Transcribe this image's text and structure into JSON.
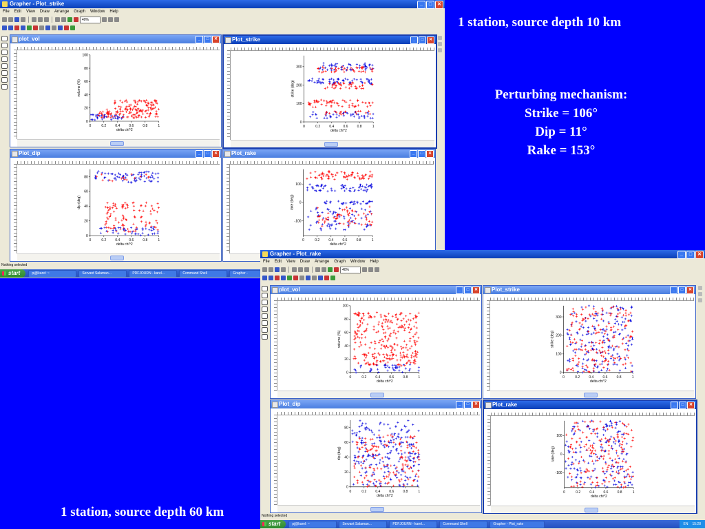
{
  "slide": {
    "heading_top": "1 station, source depth 10  km",
    "heading_bottom": "1 station, source depth 60  km",
    "mechanism": {
      "title": "Perturbing mechanism:",
      "strike": "Strike = 106°",
      "dip": "Dip = 11°",
      "rake": "Rake =  153°"
    }
  },
  "colors": {
    "slide_bg": "#0000ff",
    "series_red": "#ff0000",
    "series_blue": "#0000dd",
    "title_blue": "#0a3fb8"
  },
  "icons": [
    "app-icon",
    "minimize-icon",
    "maximize-icon",
    "close-icon",
    "windows-start-icon"
  ],
  "menu": [
    "File",
    "Edit",
    "View",
    "Draw",
    "Arrange",
    "Graph",
    "Window",
    "Help"
  ],
  "windows": [
    {
      "title": "Grapher - Plot_strike",
      "zoom": "40%",
      "status": "Nothing selected",
      "panels": [
        {
          "title": "plot_vol",
          "active": false,
          "kind": "vol",
          "density": 1,
          "y_label": "volume (%)",
          "x_label": "delta chi^2",
          "x_ticks": [
            "0",
            "0.2",
            "0.4",
            "0.6",
            "0.8",
            "1"
          ],
          "y_ticks": [
            "0",
            "20",
            "40",
            "60",
            "80",
            "100"
          ]
        },
        {
          "title": "Plot_strike",
          "active": true,
          "kind": "strike",
          "density": 1,
          "y_label": "strike (deg)",
          "x_label": "delta chi^2",
          "x_ticks": [
            "0",
            "0.2",
            "0.4",
            "0.6",
            "0.8",
            "1"
          ],
          "y_ticks": [
            "0",
            "100",
            "200",
            "300"
          ]
        },
        {
          "title": "Plot_dip",
          "active": false,
          "kind": "dip",
          "density": 1,
          "y_label": "dip (deg)",
          "x_label": "delta chi^2",
          "x_ticks": [
            "0",
            "0.2",
            "0.4",
            "0.6",
            "0.8",
            "1"
          ],
          "y_ticks": [
            "0",
            "20",
            "40",
            "60",
            "80"
          ]
        },
        {
          "title": "Plot_rake",
          "active": false,
          "kind": "rake",
          "density": 1,
          "y_label": "rake (deg)",
          "x_label": "delta chi^2",
          "x_ticks": [
            "0",
            "0.2",
            "0.4",
            "0.6",
            "0.8",
            "1"
          ],
          "y_ticks": [
            "-100",
            "0",
            "100"
          ]
        }
      ],
      "taskbar": {
        "start": "start",
        "tasks": [
          "pj@karel: ~",
          "Servant Salaman...",
          "PDFJOURN - karel...",
          "Command Shell",
          "Grapher -"
        ]
      }
    },
    {
      "title": "Grapher - Plot_rake",
      "zoom": "40%",
      "status": "Nothing selected",
      "panels": [
        {
          "title": "plot_vol",
          "active": false,
          "kind": "vol",
          "density": 2,
          "y_label": "volume (%)",
          "x_label": "delta chi^2",
          "x_ticks": [
            "0",
            "0.2",
            "0.4",
            "0.6",
            "0.8",
            "1"
          ],
          "y_ticks": [
            "0",
            "20",
            "40",
            "60",
            "80",
            "100"
          ]
        },
        {
          "title": "Plot_strike",
          "active": false,
          "kind": "strike",
          "density": 2,
          "y_label": "strike (deg)",
          "x_label": "delta chi^2",
          "x_ticks": [
            "0",
            "0.2",
            "0.4",
            "0.6",
            "0.8",
            "1"
          ],
          "y_ticks": [
            "0",
            "100",
            "200",
            "300"
          ]
        },
        {
          "title": "Plot_dip",
          "active": false,
          "kind": "dip",
          "density": 2,
          "y_label": "dip (deg)",
          "x_label": "delta chi^2",
          "x_ticks": [
            "0",
            "0.2",
            "0.4",
            "0.6",
            "0.8",
            "1"
          ],
          "y_ticks": [
            "0",
            "20",
            "40",
            "60",
            "80"
          ]
        },
        {
          "title": "Plot_rake",
          "active": true,
          "kind": "rake",
          "density": 2,
          "y_label": "rake (deg)",
          "x_label": "delta chi^2",
          "x_ticks": [
            "0",
            "0.2",
            "0.4",
            "0.6",
            "0.8",
            "1"
          ],
          "y_ticks": [
            "-100",
            "0",
            "100"
          ]
        }
      ],
      "taskbar": {
        "start": "start",
        "tasks": [
          "pj@karel: ~",
          "Servant Salaman...",
          "PDFJOURN - karel...",
          "Command Shell",
          "Grapher - Plot_rake"
        ],
        "tray_lang": "EN",
        "clock": "15:28"
      }
    }
  ]
}
